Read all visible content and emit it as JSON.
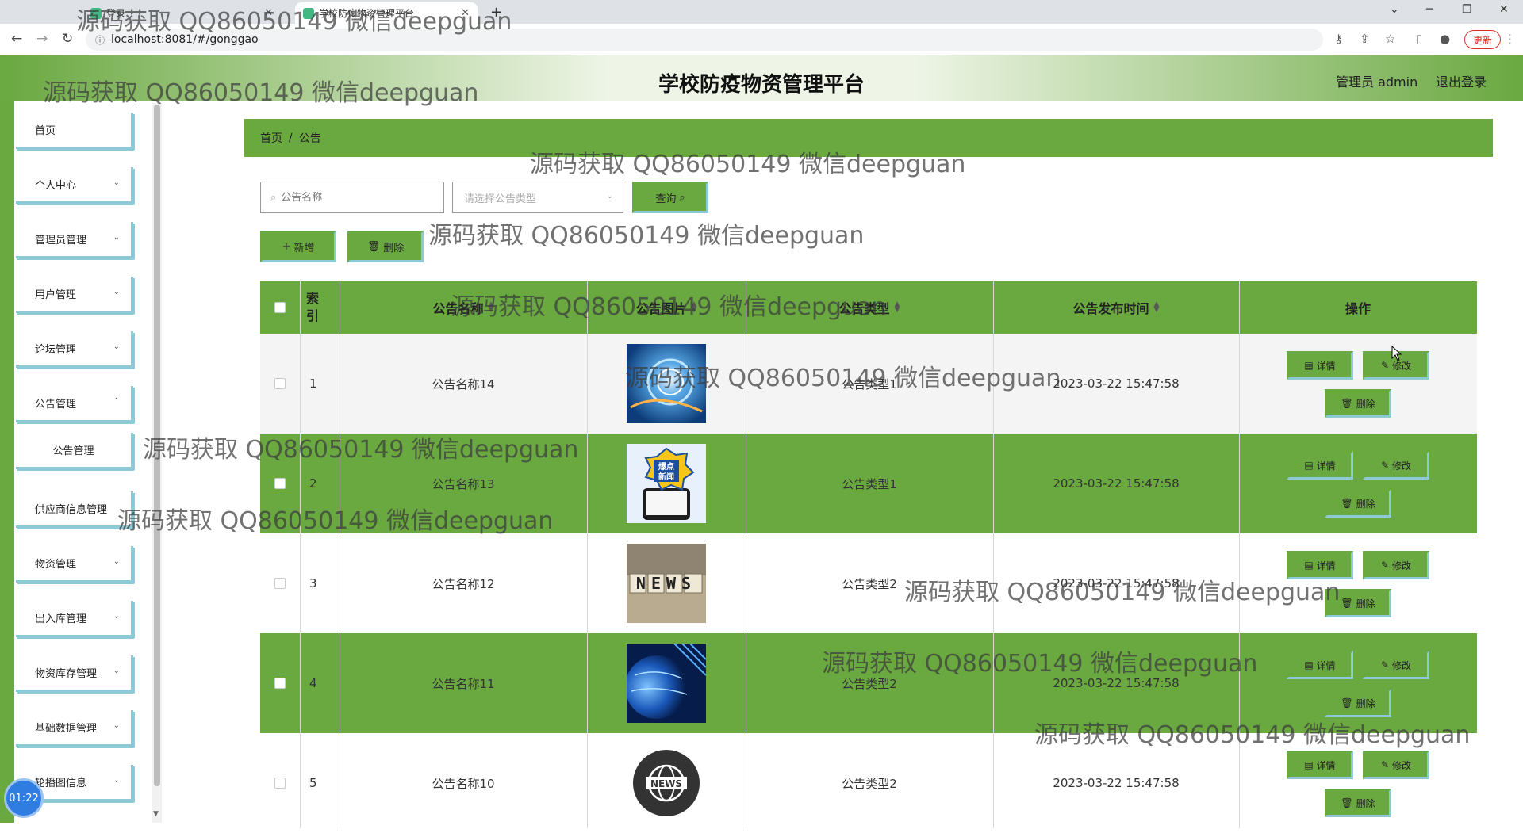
{
  "browser": {
    "tabs": [
      {
        "label": "登录"
      },
      {
        "label": "学校防疫物资管理平台"
      }
    ],
    "url": "localhost:8081/#/gonggao",
    "update_label": "更新"
  },
  "header": {
    "title": "学校防疫物资管理平台",
    "user_label": "管理员 admin",
    "logout_label": "退出登录"
  },
  "sidebar": {
    "items": [
      {
        "label": "首页",
        "expandable": false
      },
      {
        "label": "个人中心",
        "expandable": true
      },
      {
        "label": "管理员管理",
        "expandable": true
      },
      {
        "label": "用户管理",
        "expandable": true
      },
      {
        "label": "论坛管理",
        "expandable": true
      },
      {
        "label": "公告管理",
        "expandable": true
      },
      {
        "label": "公告管理",
        "expandable": false,
        "sub": true
      },
      {
        "label": "供应商信息管理",
        "expandable": false
      },
      {
        "label": "物资管理",
        "expandable": true
      },
      {
        "label": "出入库管理",
        "expandable": true
      },
      {
        "label": "物资库存管理",
        "expandable": true
      },
      {
        "label": "基础数据管理",
        "expandable": true
      },
      {
        "label": "轮播图信息",
        "expandable": true
      }
    ],
    "timer": "01:22"
  },
  "breadcrumb": {
    "home": "首页",
    "separator": "/",
    "current": "公告"
  },
  "filters": {
    "name_placeholder": "公告名称",
    "type_placeholder": "请选择公告类型",
    "search_label": "查询"
  },
  "toolbar": {
    "add_label": "新增",
    "delete_label": "删除"
  },
  "table": {
    "headers": {
      "index": "索引",
      "name": "公告名称",
      "image": "公告图片",
      "type": "公告类型",
      "time": "公告发布时间",
      "actions": "操作"
    },
    "rows": [
      {
        "index": "1",
        "name": "公告名称14",
        "type": "公告类型1",
        "time": "2023-03-22 15:47:58",
        "image": "abstract-blue"
      },
      {
        "index": "2",
        "name": "公告名称13",
        "type": "公告类型1",
        "time": "2023-03-22 15:47:58",
        "image": "breaking-news"
      },
      {
        "index": "3",
        "name": "公告名称12",
        "type": "公告类型2",
        "time": "2023-03-22 15:47:58",
        "image": "news-blocks"
      },
      {
        "index": "4",
        "name": "公告名称11",
        "type": "公告类型2",
        "time": "2023-03-22 15:47:58",
        "image": "globe"
      },
      {
        "index": "5",
        "name": "公告名称10",
        "type": "公告类型2",
        "time": "2023-03-22 15:47:58",
        "image": "news-globe-icon"
      }
    ],
    "action_labels": {
      "detail": "详情",
      "edit": "修改",
      "delete": "删除"
    },
    "image_badges": {
      "breaking_top": "爆点",
      "breaking_bottom": "新闻",
      "news": "NEWS"
    }
  },
  "watermark": "源码获取 QQ86050149 微信deepguan",
  "colors": {
    "primary": "#6aa840",
    "accent_border": "#8ec9d6",
    "row_alt": "#f4f4f4"
  }
}
